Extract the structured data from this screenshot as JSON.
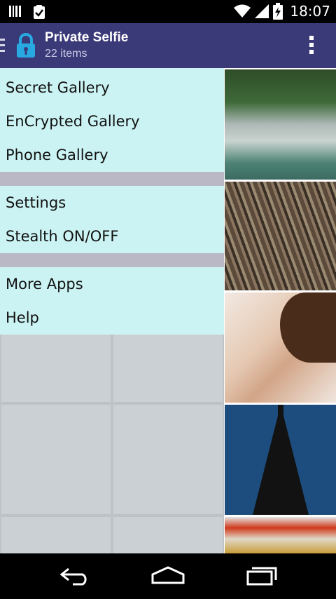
{
  "status_bar": {
    "time": "18:07",
    "left_icons": [
      "barcode-icon",
      "clipboard-check-icon"
    ],
    "right_icons": [
      "wifi-icon",
      "cell-signal-icon",
      "battery-charging-icon"
    ]
  },
  "action_bar": {
    "title": "Private Selfie",
    "subtitle": "22 items",
    "icons": [
      "drawer-toggle-icon",
      "lock-icon",
      "overflow-menu-icon"
    ],
    "color": "#3b3a78"
  },
  "drawer": {
    "background": "#ccf3f3",
    "group1": [
      "Secret Gallery",
      "EnCrypted Gallery",
      "Phone Gallery"
    ],
    "group2": [
      "Settings",
      "Stealth ON/OFF"
    ],
    "group3": [
      "More Apps",
      "Help"
    ]
  },
  "nav_bar": {
    "buttons": [
      "back-icon",
      "home-icon",
      "recents-icon"
    ]
  }
}
